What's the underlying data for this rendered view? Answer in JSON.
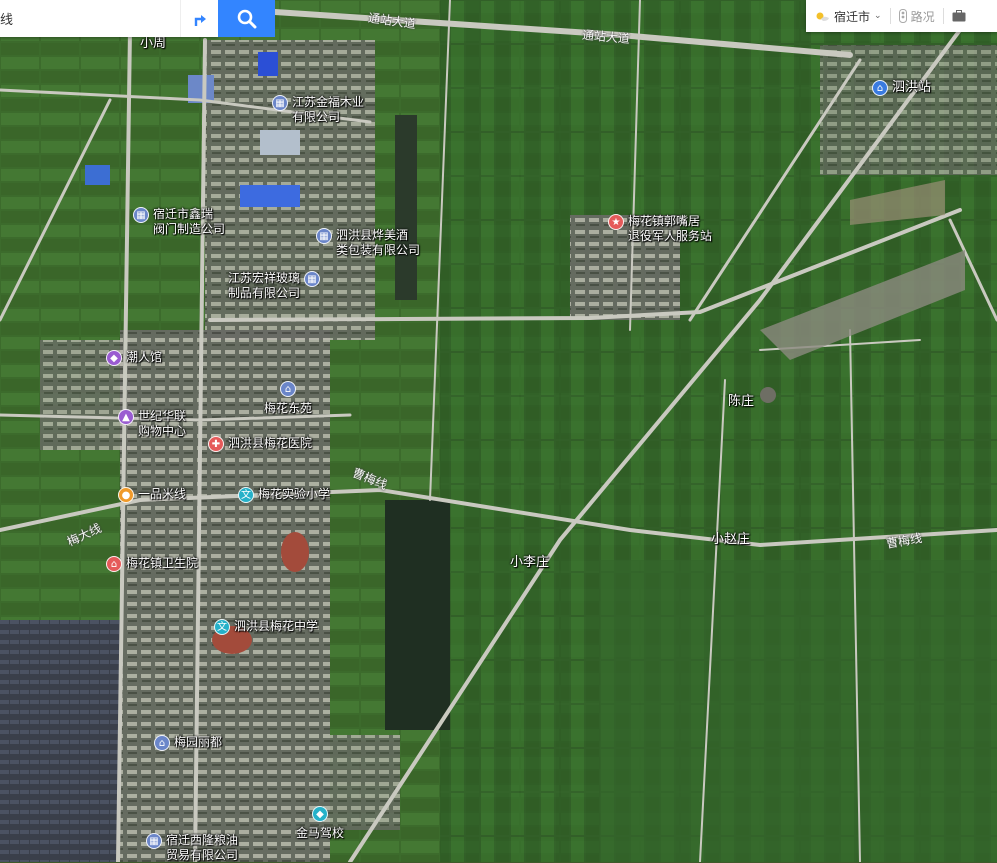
{
  "search": {
    "input_value": "线",
    "placeholder": ""
  },
  "toolbar": {
    "city": "宿迁市",
    "traffic": "路况"
  },
  "roads": [
    {
      "label": "通站大道"
    },
    {
      "label": "通站大道"
    },
    {
      "label": "曹梅线"
    },
    {
      "label": "曹梅线"
    },
    {
      "label": "梅大线"
    }
  ],
  "places": [
    {
      "label": "小周"
    },
    {
      "label": "陈庄"
    },
    {
      "label": "小赵庄"
    },
    {
      "label": "小李庄"
    }
  ],
  "pois": [
    {
      "label": "江苏金福木业\n有限公司",
      "icon": "building-icon",
      "kind": "bldg"
    },
    {
      "label": "宿迁市鑫瑞\n阀门制造公司",
      "icon": "building-icon",
      "kind": "bldg"
    },
    {
      "label": "泗洪县烨美酒\n类包装有限公司",
      "icon": "building-icon",
      "kind": "bldg"
    },
    {
      "label": "江苏宏祥玻璃\n制品有限公司",
      "icon": "building-icon",
      "kind": "bldg"
    },
    {
      "label": "潮人馆",
      "icon": "shopping-bag-icon",
      "kind": "purp"
    },
    {
      "label": "梅花东苑",
      "icon": "residence-icon",
      "kind": "bldg"
    },
    {
      "label": "世纪华联\n购物中心",
      "icon": "shopping-cart-icon",
      "kind": "purp"
    },
    {
      "label": "泗洪县梅花医院",
      "icon": "hospital-cross-icon",
      "kind": "red"
    },
    {
      "label": "一品米线",
      "icon": "food-bowl-icon",
      "kind": "orng"
    },
    {
      "label": "梅花实验小学",
      "icon": "school-icon",
      "kind": "cyan"
    },
    {
      "label": "梅花镇卫生院",
      "icon": "clinic-icon",
      "kind": "red"
    },
    {
      "label": "泗洪县梅花中学",
      "icon": "school-icon",
      "kind": "cyan"
    },
    {
      "label": "梅园丽都",
      "icon": "residence-icon",
      "kind": "bldg"
    },
    {
      "label": "金马驾校",
      "icon": "driving-school-icon",
      "kind": "cyan"
    },
    {
      "label": "宿迁西隆粮油\n贸易有限公司",
      "icon": "building-icon",
      "kind": "bldg"
    },
    {
      "label": "梅花镇郭嘴居\n退役军人服务站",
      "icon": "service-station-icon",
      "kind": "red"
    },
    {
      "label": "泗洪站",
      "icon": "station-icon",
      "kind": "blue"
    }
  ]
}
